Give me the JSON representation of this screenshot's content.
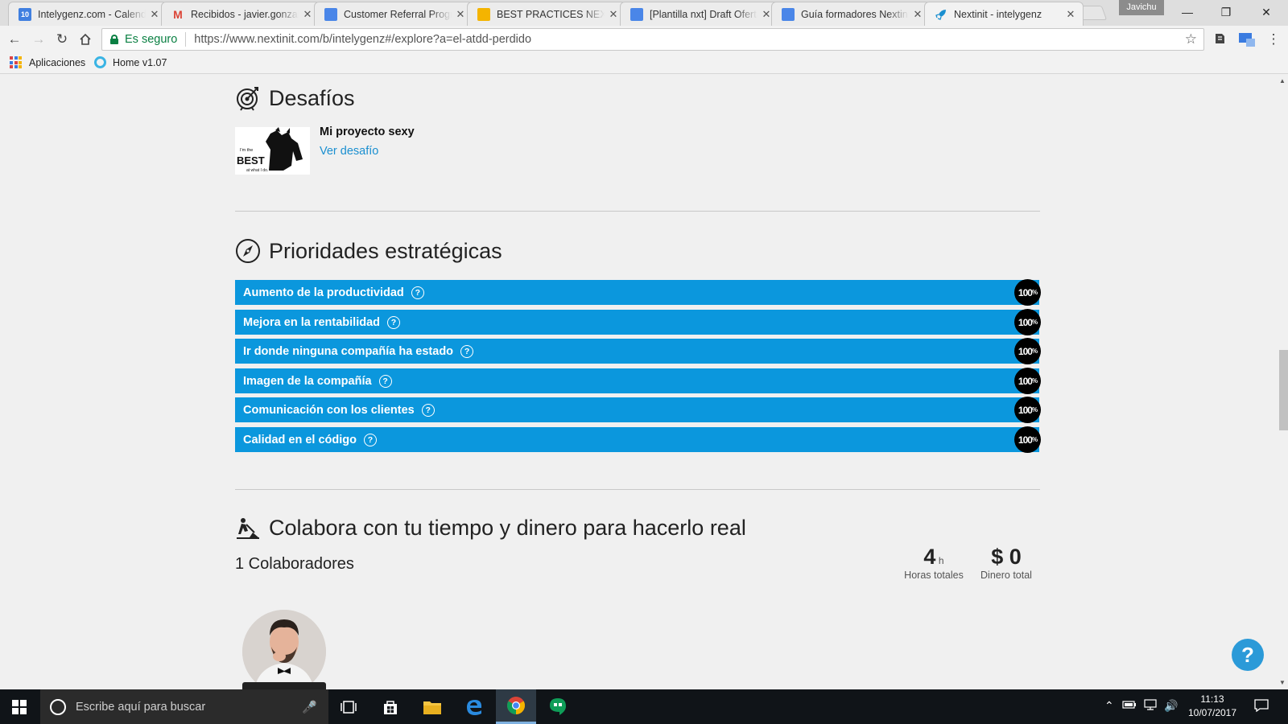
{
  "browser": {
    "tabs": [
      {
        "title": "Intelygenz.com - Calendar",
        "favicon": "calendar-icon",
        "color": "#3f7fe0",
        "favtext": "10"
      },
      {
        "title": "Recibidos - javier.gonzalez",
        "favicon": "gmail-icon",
        "color": "#db4437",
        "favtext": "M"
      },
      {
        "title": "Customer Referral Program",
        "favicon": "docs-icon",
        "color": "#4a86e8",
        "favtext": ""
      },
      {
        "title": "BEST PRACTICES NEXTINIT",
        "favicon": "slides-icon",
        "color": "#f4b400",
        "favtext": ""
      },
      {
        "title": "[Plantilla nxt] Draft Oferta",
        "favicon": "docs-icon",
        "color": "#4a86e8",
        "favtext": ""
      },
      {
        "title": "Guía formadores Nextinit",
        "favicon": "docs-icon",
        "color": "#4a86e8",
        "favtext": ""
      },
      {
        "title": "Nextinit - intelygenz",
        "favicon": "rocket-icon",
        "color": "#1a8fd0",
        "favtext": ""
      }
    ],
    "close_glyph": "✕",
    "profile_name": "Javichu",
    "secure_label": "Es seguro",
    "url": "https://www.nextinit.com/b/intelygenz#/explore?a=el-atdd-perdido",
    "bookmarks": [
      {
        "label": "Aplicaciones",
        "icon": "apps-icon"
      },
      {
        "label": "Home v1.07",
        "icon": "home-circle-icon"
      }
    ]
  },
  "challenges": {
    "title": "Desafíos",
    "item_name": "Mi proyecto sexy",
    "item_link": "Ver desafío",
    "thumb_text_1": "I'm the",
    "thumb_text_2": "BEST",
    "thumb_text_3": "at what I do."
  },
  "priorities": {
    "title": "Prioridades estratégicas",
    "help_glyph": "?",
    "items": [
      {
        "label": "Aumento de la productividad",
        "value": "100",
        "unit": "%"
      },
      {
        "label": "Mejora en la rentabilidad",
        "value": "100",
        "unit": "%"
      },
      {
        "label": "Ir donde ninguna compañía ha estado",
        "value": "100",
        "unit": "%"
      },
      {
        "label": "Imagen de la compañía",
        "value": "100",
        "unit": "%"
      },
      {
        "label": "Comunicación con los clientes",
        "value": "100",
        "unit": "%"
      },
      {
        "label": "Calidad en el código",
        "value": "100",
        "unit": "%"
      }
    ]
  },
  "collaborate": {
    "title": "Colabora con tu tiempo y dinero para hacerlo real",
    "collaborators_label": "1 Colaboradores",
    "hours_value": "4",
    "hours_unit": "h",
    "hours_label": "Horas totales",
    "money_value": "$ 0",
    "money_label": "Dinero total"
  },
  "help_fab_glyph": "?",
  "taskbar": {
    "search_placeholder": "Escribe aquí para buscar",
    "time": "11:13",
    "date": "10/07/2017"
  }
}
